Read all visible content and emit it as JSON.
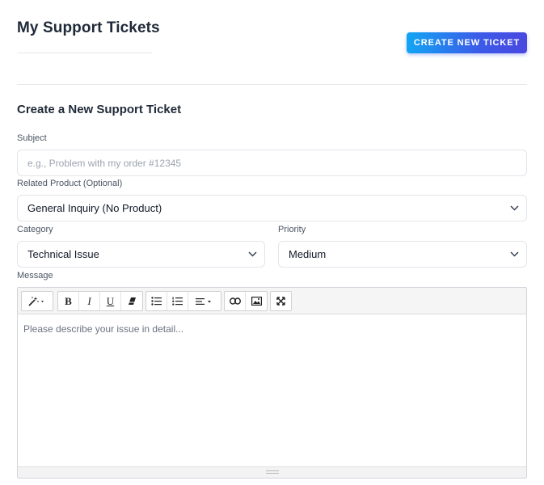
{
  "header": {
    "title": "My Support Tickets",
    "create_button_label": "CREATE NEW TICKET"
  },
  "form": {
    "title": "Create a New Support Ticket",
    "subject": {
      "label": "Subject",
      "placeholder": "e.g., Problem with my order #12345",
      "value": ""
    },
    "product": {
      "label": "Related Product (Optional)",
      "selected": "General Inquiry (No Product)"
    },
    "category": {
      "label": "Category",
      "selected": "Technical Issue"
    },
    "priority": {
      "label": "Priority",
      "selected": "Medium"
    },
    "message": {
      "label": "Message",
      "placeholder": "Please describe your issue in detail...",
      "toolbar": [
        {
          "group": "style",
          "icons": [
            "magic-wand-icon"
          ]
        },
        {
          "group": "font",
          "icons": [
            "bold-icon",
            "italic-icon",
            "underline-icon",
            "eraser-icon"
          ]
        },
        {
          "group": "para",
          "icons": [
            "unordered-list-icon",
            "ordered-list-icon",
            "align-icon"
          ]
        },
        {
          "group": "insert",
          "icons": [
            "link-icon",
            "image-icon"
          ]
        },
        {
          "group": "view",
          "icons": [
            "fullscreen-icon"
          ]
        }
      ]
    }
  },
  "colors": {
    "button_gradient_start": "#12a5f4",
    "button_gradient_end": "#4a47e0",
    "text_primary": "#1f2937",
    "border": "#e2e5ea"
  }
}
